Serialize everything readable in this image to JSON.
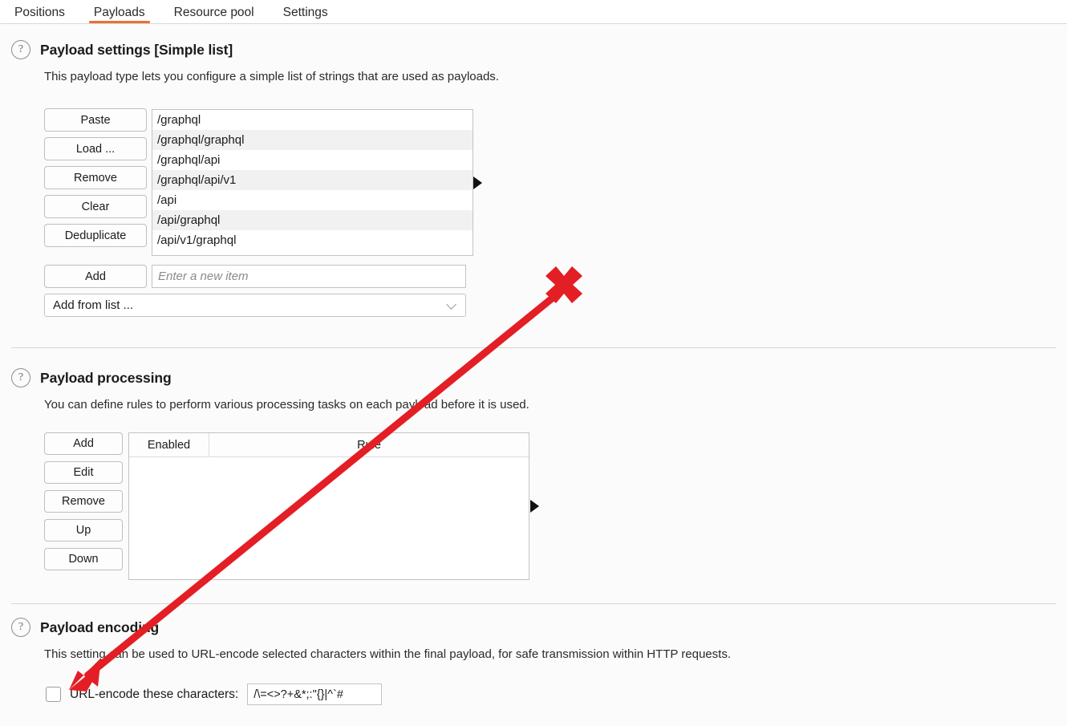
{
  "tabs": [
    {
      "label": "Positions",
      "active": false
    },
    {
      "label": "Payloads",
      "active": true
    },
    {
      "label": "Resource pool",
      "active": false
    },
    {
      "label": "Settings",
      "active": false
    }
  ],
  "accent_color": "#eb7033",
  "annotation_color": "#e31e24",
  "payload_settings": {
    "help_icon": "question-mark-icon",
    "title": "Payload settings [Simple list]",
    "description": "This payload type lets you configure a simple list of strings that are used as payloads.",
    "buttons": [
      "Paste",
      "Load ...",
      "Remove",
      "Clear",
      "Deduplicate"
    ],
    "add_button": "Add",
    "items": [
      "/graphql",
      "/graphql/graphql",
      "/graphql/api",
      "/graphql/api/v1",
      "/api",
      "/api/graphql",
      "/api/v1/graphql"
    ],
    "new_item_placeholder": "Enter a new item",
    "new_item_value": "",
    "add_from_list_label": "Add from list ...",
    "expander_icon": "triangle-right-icon"
  },
  "payload_processing": {
    "help_icon": "question-mark-icon",
    "title": "Payload processing",
    "description": "You can define rules to perform various processing tasks on each payload before it is used.",
    "buttons": [
      "Add",
      "Edit",
      "Remove",
      "Up",
      "Down"
    ],
    "columns": [
      "Enabled",
      "Rule"
    ],
    "rows": [],
    "expander_icon": "triangle-right-icon"
  },
  "payload_encoding": {
    "help_icon": "question-mark-icon",
    "title": "Payload encoding",
    "description": "This setting can be used to URL-encode selected characters within the final payload, for safe transmission within HTTP requests.",
    "checkbox_checked": false,
    "checkbox_label": "URL-encode these characters:",
    "characters_value": "/\\=<>?+&*;:\"{}|^`#"
  },
  "annotations": {
    "x_mark": "red-x-mark",
    "arrow": "red-arrow-pointing-to-url-encode-checkbox"
  }
}
